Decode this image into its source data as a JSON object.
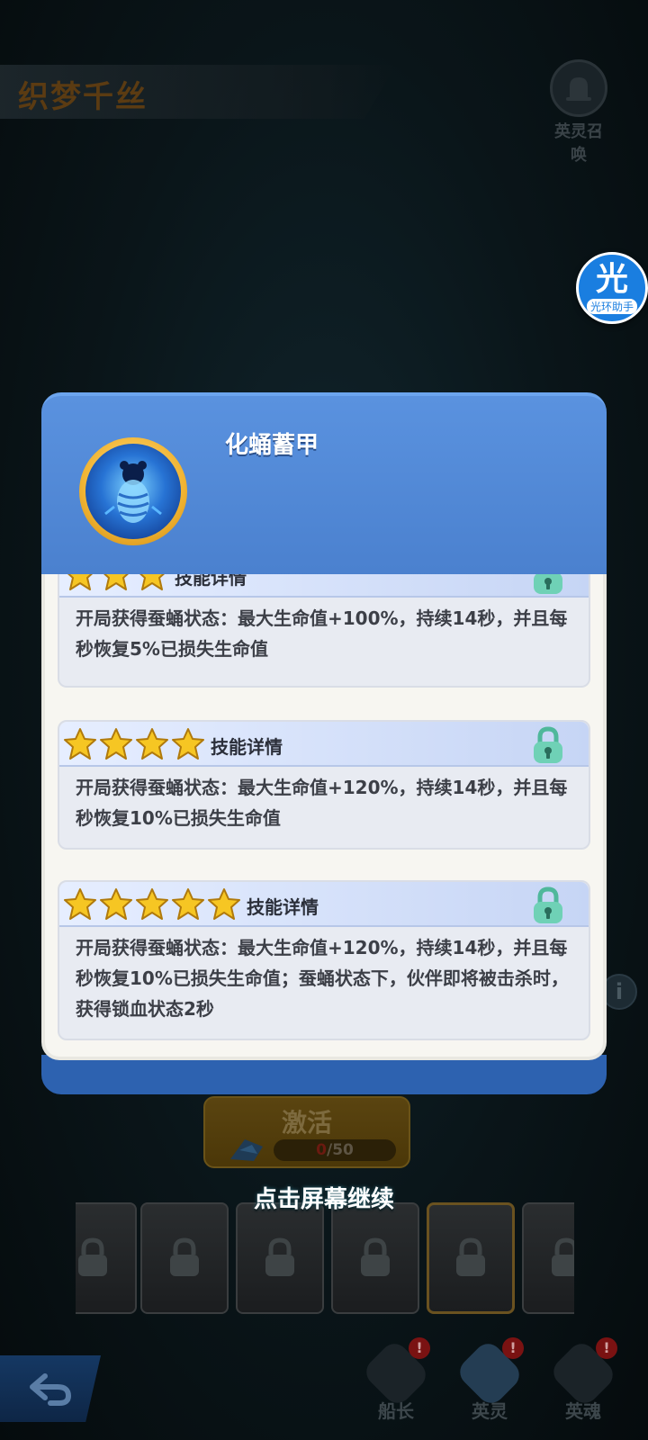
{
  "background": {
    "title": "织梦千丝",
    "summon_label": "英灵召唤",
    "helper": {
      "glyph": "光",
      "label": "光环助手"
    },
    "info_glyph": "i",
    "activate": {
      "label": "激活",
      "current": "0",
      "separator_total": "/50"
    },
    "continue_hint": "点击屏幕继续",
    "bottom_nav": [
      {
        "label": "船长",
        "badge": "!"
      },
      {
        "label": "英灵",
        "badge": "!"
      },
      {
        "label": "英魂",
        "badge": "!"
      }
    ]
  },
  "modal": {
    "skill_name": "化蛹蓄甲",
    "tiers": [
      {
        "stars": 3,
        "header": "技能详情",
        "locked": true,
        "description": "开局获得蚕蛹状态：最大生命值+100%，持续14秒，并且每秒恢复5%已损失生命值"
      },
      {
        "stars": 4,
        "header": "技能详情",
        "locked": true,
        "description": "开局获得蚕蛹状态：最大生命值+120%，持续14秒，并且每秒恢复10%已损失生命值"
      },
      {
        "stars": 5,
        "header": "技能详情",
        "locked": true,
        "description": "开局获得蚕蛹状态：最大生命值+120%，持续14秒，并且每秒恢复10%已损失生命值；蚕蛹状态下，伙伴即将被击杀时，获得锁血状态2秒"
      }
    ]
  },
  "colors": {
    "modal_header": "#4a80ce",
    "modal_body": "#f7f6f1",
    "star": "#f6c623",
    "lock": "#5cc2a8"
  }
}
